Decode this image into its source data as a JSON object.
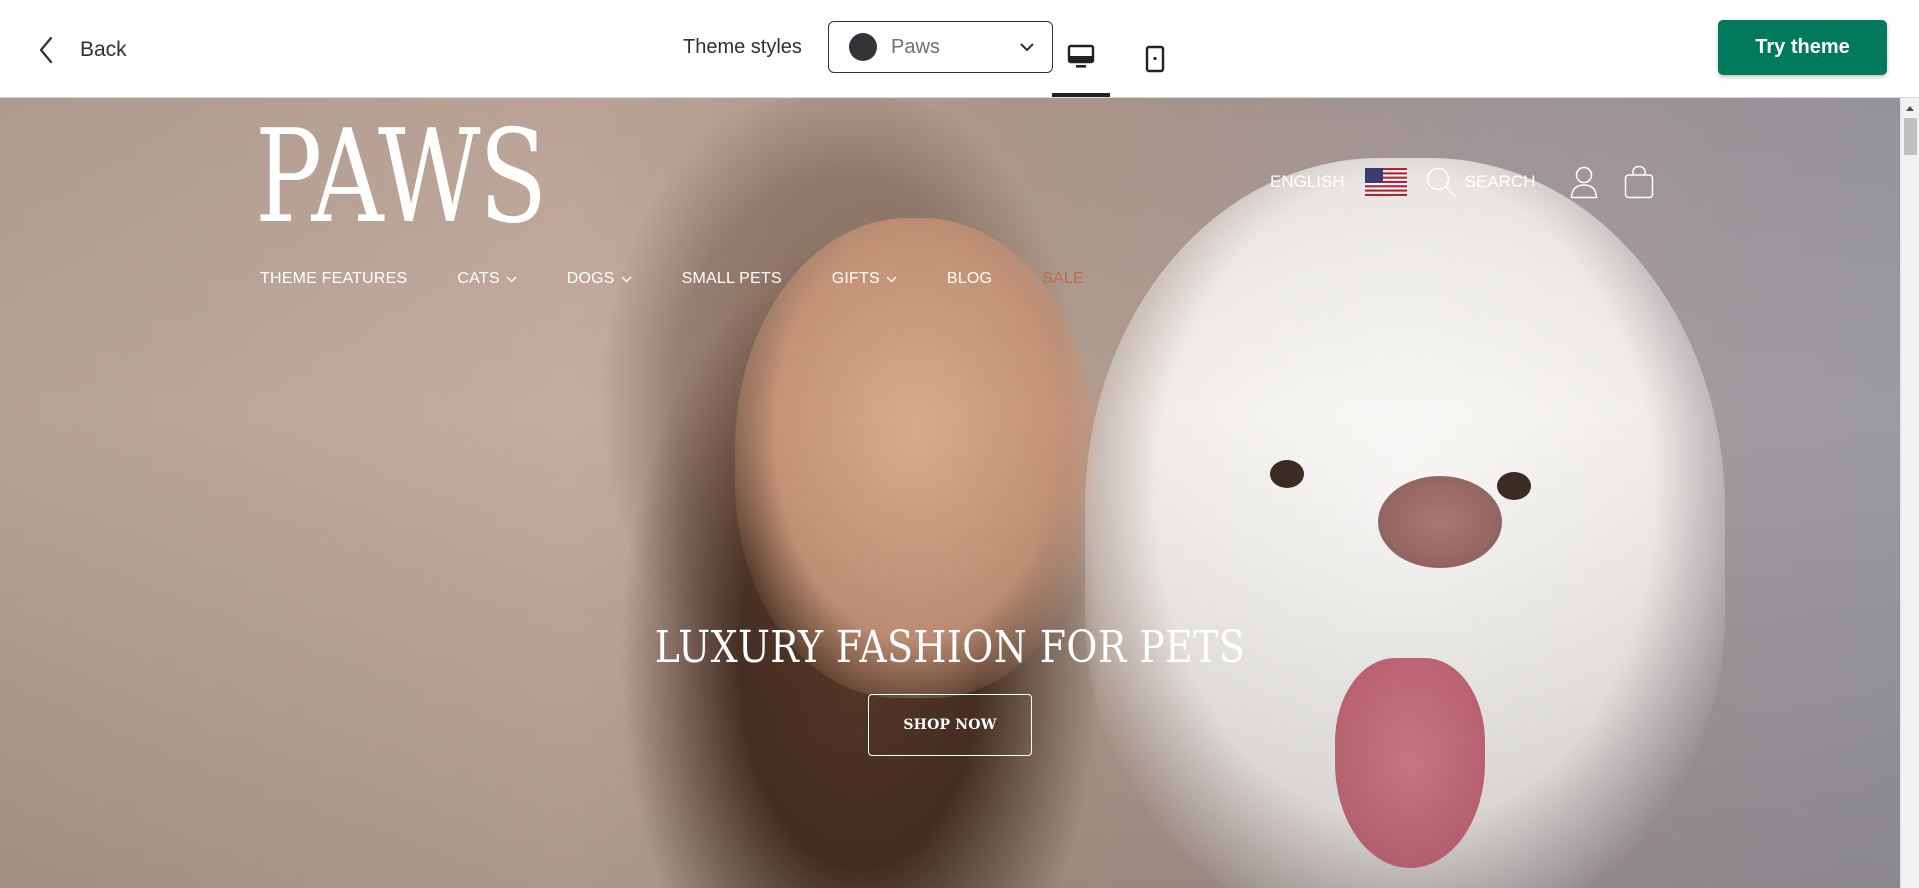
{
  "toolbar": {
    "back_label": "Back",
    "theme_styles_label": "Theme styles",
    "style_select": {
      "value": "Paws",
      "swatch_color": "#333438"
    },
    "devices": [
      {
        "name": "desktop",
        "icon": "desktop-icon",
        "active": true
      },
      {
        "name": "mobile",
        "icon": "mobile-icon",
        "active": false
      }
    ],
    "try_button_label": "Try theme",
    "accent_color": "#007a5a"
  },
  "store": {
    "logo": "PAWS",
    "nav": [
      {
        "label": "THEME FEATURES",
        "dropdown": false
      },
      {
        "label": "CATS",
        "dropdown": true
      },
      {
        "label": "DOGS",
        "dropdown": true
      },
      {
        "label": "SMALL PETS",
        "dropdown": false
      },
      {
        "label": "GIFTS",
        "dropdown": true
      },
      {
        "label": "BLOG",
        "dropdown": false
      },
      {
        "label": "SALE",
        "dropdown": false,
        "color": "#c06a4a"
      }
    ],
    "utility": {
      "language": "ENGLISH",
      "flag_icon": "us-flag-icon",
      "search_label": "SEARCH",
      "account_icon": "account-icon",
      "cart_icon": "cart-icon"
    }
  },
  "hero": {
    "title": "LUXURY FASHION FOR PETS",
    "button_label": "SHOP NOW"
  }
}
